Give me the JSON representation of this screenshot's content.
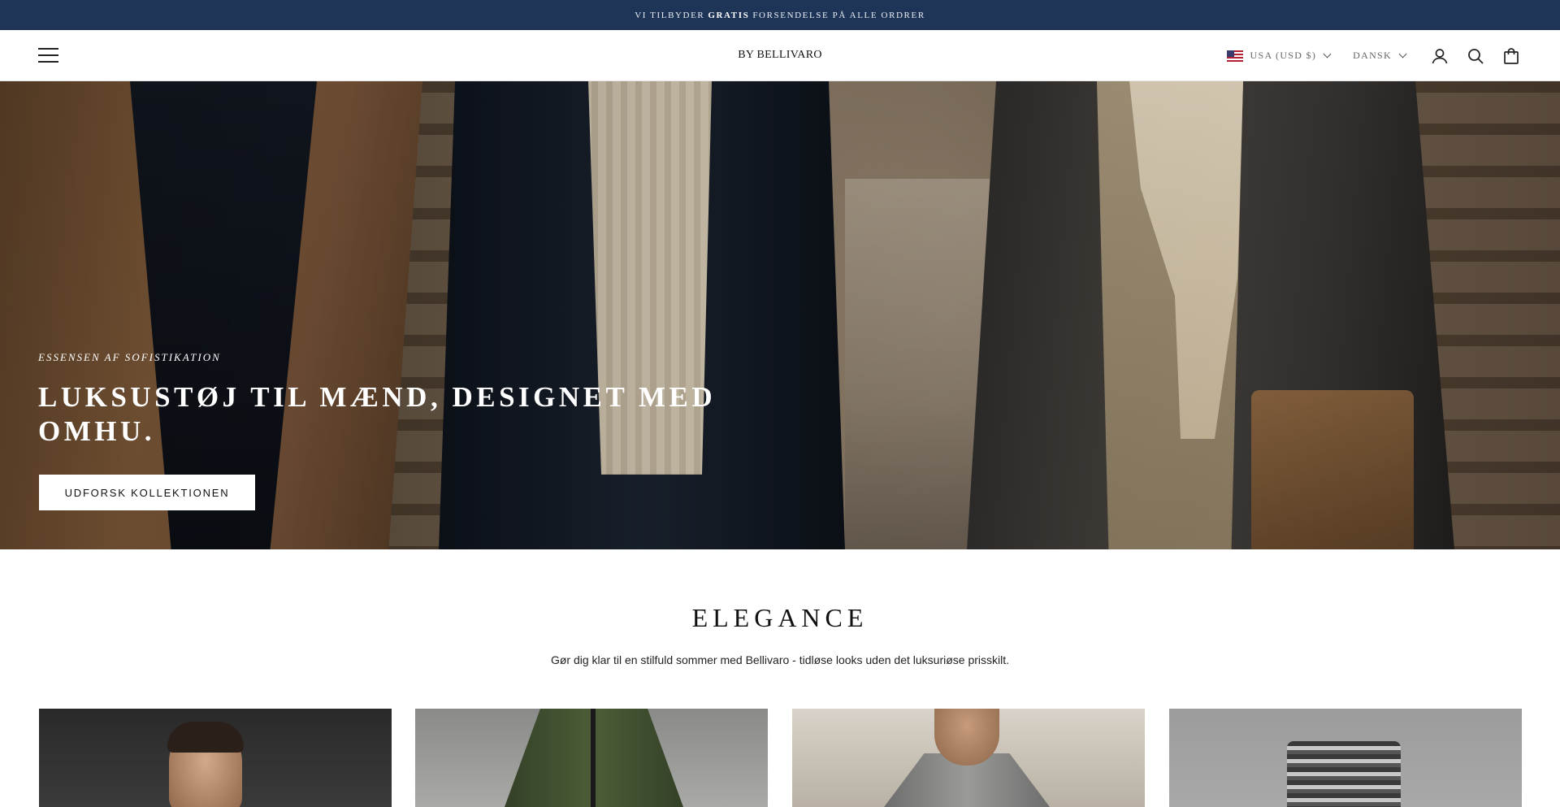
{
  "announcement": {
    "prefix": "VI TILBYDER",
    "highlight": "GRATIS",
    "suffix": "FORSENDELSE PÅ ALLE ORDRER"
  },
  "header": {
    "logo": "BY BELLIVARO",
    "country_selector": "USA (USD $)",
    "language_selector": "DANSK",
    "icons": [
      "menu-icon",
      "flag-us-icon",
      "account-icon",
      "search-icon",
      "cart-icon"
    ]
  },
  "hero": {
    "subheading": "ESSENSEN AF SOFISTIKATION",
    "title": "LUKSUSTØJ TIL MÆND, DESIGNET MED OMHU.",
    "cta_label": "UDFORSK KOLLEKTIONEN"
  },
  "collection": {
    "title": "ELEGANCE",
    "description": "Gør dig klar til en stilfuld sommer med Bellivaro - tidløse looks uden det luksuriøse prisskilt."
  },
  "colors": {
    "announcement_bg": "#1f3558",
    "text_primary": "#111111",
    "cta_bg": "#ffffff"
  }
}
